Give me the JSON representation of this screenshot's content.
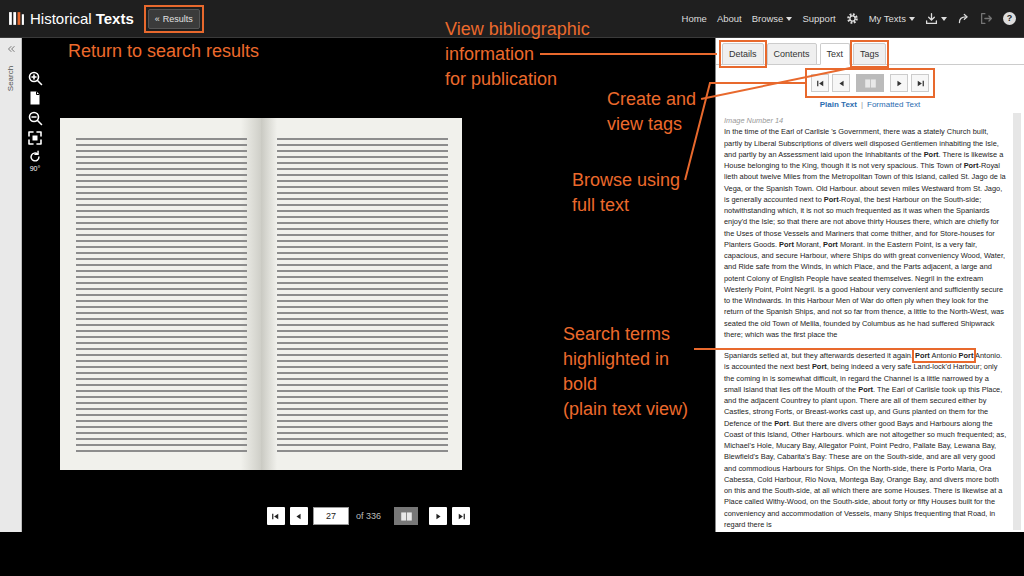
{
  "header": {
    "logo": [
      "Historical",
      "Texts"
    ],
    "results_button": {
      "icon": "«",
      "label": "Results",
      "annotated": true
    },
    "nav": [
      {
        "kind": "link",
        "label": "Home",
        "dropdown": false,
        "disabled": false
      },
      {
        "kind": "link",
        "label": "About",
        "dropdown": false,
        "disabled": false
      },
      {
        "kind": "link",
        "label": "Browse",
        "dropdown": true,
        "disabled": false
      },
      {
        "kind": "link",
        "label": "Support",
        "dropdown": false,
        "disabled": false
      },
      {
        "kind": "icon",
        "dropdown": false,
        "disabled": false
      },
      {
        "kind": "link",
        "label": "My Texts",
        "dropdown": true,
        "disabled": false
      },
      {
        "kind": "icon",
        "dropdown": true,
        "disabled": false
      },
      {
        "kind": "icon",
        "dropdown": false,
        "disabled": false
      },
      {
        "kind": "icon",
        "dropdown": false,
        "disabled": true
      },
      {
        "kind": "glyph",
        "glyph": "?",
        "dropdown": false,
        "disabled": false
      }
    ]
  },
  "sidebar": {
    "label": "Search"
  },
  "viewer": {
    "rotate_label": "90°",
    "page": "27",
    "page_count": "of 336"
  },
  "panel": {
    "tabs": [
      {
        "label": "Details",
        "selected": false,
        "annotated": true
      },
      {
        "label": "Contents",
        "selected": false,
        "annotated": false
      },
      {
        "label": "Text",
        "selected": true,
        "annotated": false
      },
      {
        "label": "Tags",
        "selected": false,
        "annotated": true
      }
    ],
    "page_nav": {
      "annotated": true
    },
    "views": [
      {
        "label": "Plain Text",
        "selected": true
      },
      {
        "label": "Formatted Text",
        "selected": false
      }
    ],
    "view_separator": "|",
    "image_number": "Image Number 14",
    "paragraphs": [
      [
        {
          "kind": "text",
          "text": "In the time of the Earl of Carlisle 's Government, there was a stately Church built, partly by Liberal Subscriptions of divers well disposed Gentlemen inhabiting the Isle, and partly by an Assessment laid upon the Inhabitants of the ",
          "bold": false
        },
        {
          "kind": "text",
          "text": "Port",
          "bold": true
        },
        {
          "kind": "text",
          "text": ". There is likewise a House belonging to the King, though it is not very spacious. This Town of ",
          "bold": false
        },
        {
          "kind": "text",
          "text": "Port",
          "bold": true
        },
        {
          "kind": "text",
          "text": "-Royal lieth about twelve Miles from the Metropolitan Town of this Island, called St. Jago de la Vega, or the Spanish Town. Old Harbour. about seven miles Westward from St. Jago, is generally accounted next to ",
          "bold": false
        },
        {
          "kind": "text",
          "text": "Port",
          "bold": true
        },
        {
          "kind": "text",
          "text": "-Royal, the best Harbour on the South-side; notwithstanding which, it is not so much frequented as it was when the Spaniards enjoy'd the Isle; so that there are not above thirty Houses there, which are chiefly for the Uses of those Vessels and Mariners that come thither, and for Store-houses for Planters Goods. ",
          "bold": false
        },
        {
          "kind": "text",
          "text": "Port",
          "bold": true
        },
        {
          "kind": "text",
          "text": " Morant, ",
          "bold": false
        },
        {
          "kind": "text",
          "text": "Port",
          "bold": true
        },
        {
          "kind": "text",
          "text": " Morant. in the Eastern Point, is a very fair, capacious, and secure Harbour, where Ships do with great conveniency Wood, Water, and Ride safe from the Winds, in which Place, and the Parts adjacent, a large and potent Colony of English People have seated themselves. Negril in the extream Westerly Point, Point Negril. is a good Habour very convenient and sufficiently secure to the Windwards. In this Harbour Men of War do often ply when they look for the return of the Spanish Ships, and not so far from thence, a little to the North-West, was seated the old Town of Melila, founded by Columbus as he had suffered Shipwrack there; which was the first place the",
          "bold": false
        }
      ],
      [
        {
          "kind": "text",
          "text": "Spaniards setled at, but they afterwards deserted it again. ",
          "bold": false
        },
        {
          "kind": "group",
          "annotated": true,
          "segments": [
            {
              "text": "Port",
              "bold": true
            },
            {
              "text": " Antonio ",
              "bold": false
            },
            {
              "text": "Port",
              "bold": true
            }
          ]
        },
        {
          "kind": "text",
          "text": " Antonio. is accounted the next best ",
          "bold": false
        },
        {
          "kind": "text",
          "text": "Port",
          "bold": true
        },
        {
          "kind": "text",
          "text": ", being indeed a very safe Land-lock'd Harbour; only the coming in is somewhat difficult, in regard the Channel is a little narrowed by a small Island that lies off the Mouth of the ",
          "bold": false
        },
        {
          "kind": "text",
          "text": "Port",
          "bold": true
        },
        {
          "kind": "text",
          "text": ". The Earl of Carlisle took up this Place, and the adjacent Countrey to plant upon. There are all of them secured either by Castles, strong Forts, or Breast-works cast up, and Guns planted on them for the Defence of the ",
          "bold": false
        },
        {
          "kind": "text",
          "text": "Port",
          "bold": true
        },
        {
          "kind": "text",
          "text": ". But there are divers other good Bays and Harbours along the Coast of this Island, Other Harbours. which are not altogether so much frequented; as, Michael's Hole, Mucary Bay, Allegator Point, Point Pedro, Pallate Bay, Lewana Bay, Blewfield's Bay, Cabarita's Bay: These are on the South-side, and are all very good and commodious Harbours for Ships. On the North-side, there is Porto Maria, Ora Cabessa, Cold Harbour, Rio Nova, Montega Bay, Orange Bay, and divers more both on this and the South-side, at all which there are some Houses. There is likewise at a Place called Withy-Wood, on the South-side, about forty or fifty Houses built for the conveniency and accommodation of Vessels, many Ships frequenting that Road, in regard there is",
          "bold": false
        }
      ]
    ]
  },
  "annotations": [
    {
      "lines": [
        "Return to search results"
      ]
    },
    {
      "lines": [
        "View bibliographic",
        "information",
        "for publication"
      ]
    },
    {
      "lines": [
        "Create and",
        "view tags"
      ]
    },
    {
      "lines": [
        "Browse using",
        "full text"
      ]
    },
    {
      "lines": [
        "Search terms",
        "highlighted in",
        "bold",
        "(plain text view)"
      ]
    }
  ]
}
